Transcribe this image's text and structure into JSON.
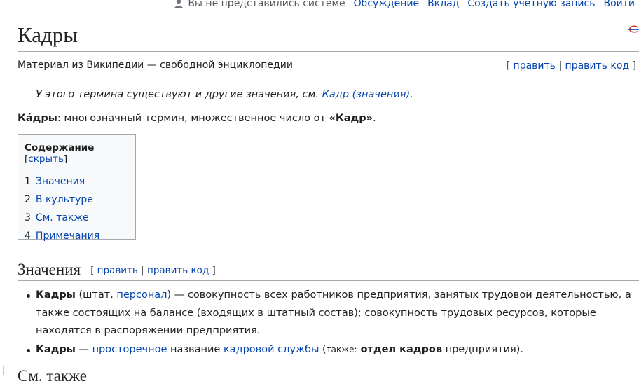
{
  "personal": {
    "anon_text": "Вы не представились системе",
    "links": [
      "Обсуждение",
      "Вклад",
      "Создать учетную запись",
      "Войти"
    ]
  },
  "title": "Кадры",
  "tagline": "Материал из Википедии — свободной энциклопедии",
  "edit_links": {
    "open": "[ ",
    "edit": "править",
    "sep": " | ",
    "edit_source": "править код",
    "close": " ]"
  },
  "hatnote": {
    "text": "У этого термина существуют и другие значения, см. ",
    "link": "Кадр (значения)",
    "end": "."
  },
  "lead": {
    "term": "Ка́дры",
    "text": ": многозначный термин, множественное число от ",
    "ref": "«Кадр»",
    "end": "."
  },
  "toc": {
    "heading": "Содержание",
    "toggle_open": " [",
    "toggle": "скрыть",
    "toggle_close": "]",
    "items": [
      {
        "num": "1",
        "label": "Значения"
      },
      {
        "num": "2",
        "label": "В культуре"
      },
      {
        "num": "3",
        "label": "См. также"
      },
      {
        "num": "4",
        "label": "Примечания"
      }
    ]
  },
  "section": {
    "heading": "Значения"
  },
  "meanings": [
    {
      "term": "Кадры",
      "p1": " (штат, ",
      "link": "персонал",
      "p2": ") — совокупность всех работников предприятия, занятых трудовой деятельностью, а также состоящих на балансе (входящих в штатный состав); совокупность трудовых ресурсов, которые находятся в распоряжении предприятия."
    },
    {
      "term": "Кадры",
      "p1": " — ",
      "link1": "просторечное",
      "p2": " название ",
      "link2": "кадровой службы",
      "p3": " (",
      "small": "также:",
      "bold": " отдел кадров",
      "p4": " предприятия)."
    }
  ],
  "next_heading": "См. также",
  "colors": {
    "link": "#0645ad",
    "text": "#202122",
    "border": "#a2a9b1",
    "toc_bg": "#f8f9fa"
  }
}
